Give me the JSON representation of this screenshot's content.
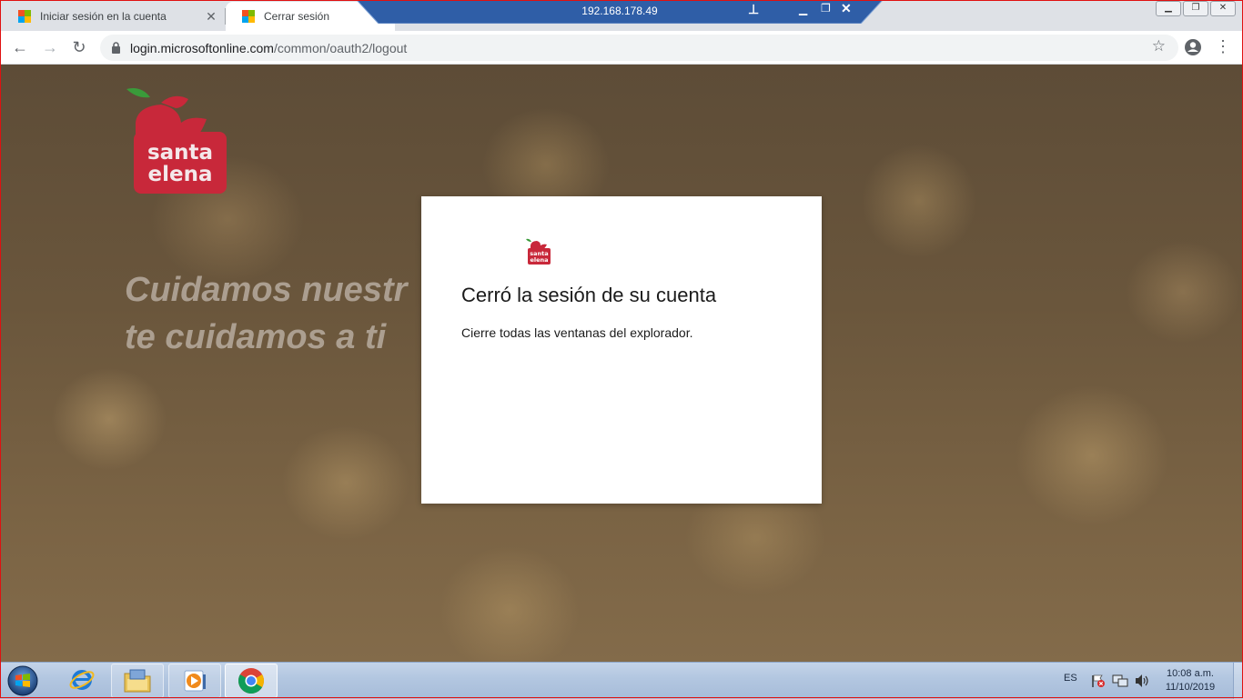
{
  "browser": {
    "tabs": [
      {
        "title": "Iniciar sesión en la cuenta",
        "active": false,
        "icon": "microsoft-logo-icon"
      },
      {
        "title": "Cerrar sesión",
        "active": true,
        "icon": "microsoft-logo-icon"
      }
    ],
    "url_host": "login.microsoftonline.com",
    "url_path": "/common/oauth2/logout"
  },
  "remote_bar": {
    "host": "192.168.178.49"
  },
  "page": {
    "brand_line1": "santa",
    "brand_line2": "elena",
    "slogan_line1": "Cuidamos nuestr",
    "slogan_line2": "te cuidamos a ti",
    "dialog": {
      "title": "Cerró la sesión de su cuenta",
      "message": "Cierre todas las ventanas del explorador."
    }
  },
  "taskbar": {
    "language": "ES",
    "time": "10:08 a.m.",
    "date": "11/10/2019"
  },
  "colors": {
    "brand_red": "#c8283a",
    "leaf_green": "#3a9b3a",
    "taskbar": "#b2c6e0"
  }
}
